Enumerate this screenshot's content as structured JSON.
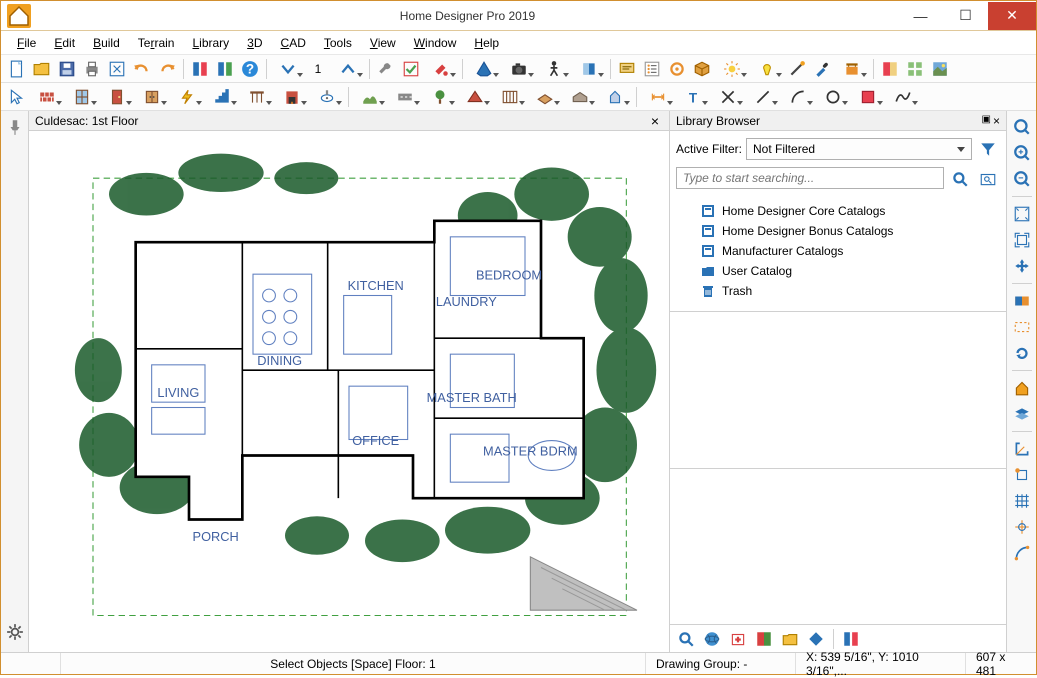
{
  "app": {
    "title": "Home Designer Pro 2019"
  },
  "menu": [
    "File",
    "Edit",
    "Build",
    "Terrain",
    "Library",
    "3D",
    "CAD",
    "Tools",
    "View",
    "Window",
    "Help"
  ],
  "floor_number": "1",
  "document": {
    "title": "Culdesac:  1st Floor"
  },
  "library": {
    "panel_title": "Library Browser",
    "filter_label": "Active Filter:",
    "filter_value": "Not Filtered",
    "search_placeholder": "Type to start searching...",
    "tree": [
      {
        "label": "Home Designer Core Catalogs",
        "icon": "catalog"
      },
      {
        "label": "Home Designer Bonus Catalogs",
        "icon": "catalog"
      },
      {
        "label": "Manufacturer Catalogs",
        "icon": "catalog"
      },
      {
        "label": "User Catalog",
        "icon": "folder"
      },
      {
        "label": "Trash",
        "icon": "trash"
      }
    ]
  },
  "status": {
    "center": "Select Objects [Space]  Floor: 1",
    "group": "Drawing Group: -",
    "coords": "X: 539 5/16\", Y: 1010 3/16\",...",
    "dims": "607 x 481"
  },
  "floorplan": {
    "rooms": [
      "LIVING",
      "DINING",
      "KITCHEN",
      "LAUNDRY",
      "BEDROOM",
      "OFFICE",
      "MASTER BATH",
      "MASTER BDRM",
      "PORCH"
    ]
  }
}
